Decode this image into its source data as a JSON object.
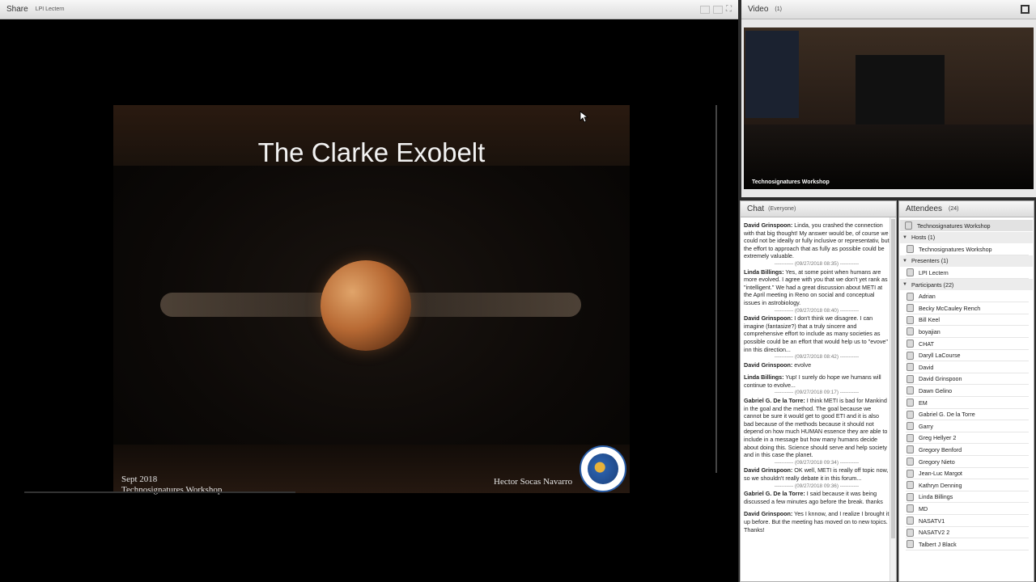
{
  "share": {
    "title": "Share",
    "subtitle": "LPI Lectern"
  },
  "slide": {
    "title": "The Clarke Exobelt",
    "date": "Sept 2018",
    "workshop": "Technosignatures Workshop",
    "author": "Hector Socas Navarro"
  },
  "video": {
    "title": "Video",
    "count": "(1)",
    "label": "Technosignatures Workshop"
  },
  "chat": {
    "title": "Chat",
    "scope": "(Everyone)",
    "messages": [
      {
        "author": "David Grinspoon:",
        "text": " Linda, you crashed the connection with that big thought! My answer would be, of course we could not be ideally or fully inclusive or representativ, but the effort to approach that as fully as possible could be extremely valuable."
      },
      {
        "stamp": "(09/27/2018 08:35)"
      },
      {
        "author": "Linda Billings:",
        "text": " Yes, at some point when humans are more evolved. I agree with you that we don't yet rank as \"intelligent.\" We had a great discussion about METI at the April meeting in Reno on social and conceptual issues in astrobiology."
      },
      {
        "stamp": "(09/27/2018 08:40)"
      },
      {
        "author": "David Grinspoon:",
        "text": " I don't think we disagree. I can imagine (fantasize?) that a truly sincere and comprehensive effort to include as many societies as possible could be an effort that would help us to \"evove\" inn this direction..."
      },
      {
        "stamp": "(09/27/2018 08:42)"
      },
      {
        "author": "David Grinspoon:",
        "text": " evolve"
      },
      {
        "author": "Linda Billings:",
        "text": " Yup! I surely do hope we humans will continue to evolve..."
      },
      {
        "stamp": "(09/27/2018 09:17)"
      },
      {
        "author": "Gabriel G. De la Torre:",
        "text": " I think METI is bad for Mankind in the goal and the method. The goal because we cannot be sure it would get to good ETI and it is also bad because of the methods because it should not depend on how much HUMAN essence they are able to include in a message but how many humans decide about doing this. Science should serve and help society and in this case the planet."
      },
      {
        "stamp": "(09/27/2018 09:34)"
      },
      {
        "author": "David Grinspoon:",
        "text": " OK well, METI is really off topic now, so we shouldn't really debate it in this forum..."
      },
      {
        "stamp": "(09/27/2018 09:36)"
      },
      {
        "author": "Gabriel G. De la Torre:",
        "text": " I said because it was being discussed a few minutes ago before the break. thanks"
      },
      {
        "author": "David Grinspoon:",
        "text": " Yes I knnow, and I realize I brought it up before. But the meeting has moved on to new topics.  Thanks!"
      }
    ]
  },
  "attendees": {
    "title": "Attendees",
    "count": "(24)",
    "organizer": "Technosignatures Workshop",
    "hosts_label": "Hosts (1)",
    "hosts": [
      "Technosignatures Workshop"
    ],
    "presenters_label": "Presenters (1)",
    "presenters": [
      "LPI Lectern"
    ],
    "participants_label": "Participants (22)",
    "participants": [
      "Adrian",
      "Becky McCauley Rench",
      "Bill Keel",
      "boyajian",
      "CHAT",
      "Daryll LaCourse",
      "David",
      "David Grinspoon",
      "Dawn Gelino",
      "EM",
      "Gabriel G. De la Torre",
      "Garry",
      "Greg Hellyer 2",
      "Gregory Benford",
      "Gregory Nieto",
      "Jean-Luc Margot",
      "Kathryn Denning",
      "Linda Billings",
      "MD",
      "NASATV1",
      "NASATV2 2",
      "Talbert J Black"
    ]
  }
}
